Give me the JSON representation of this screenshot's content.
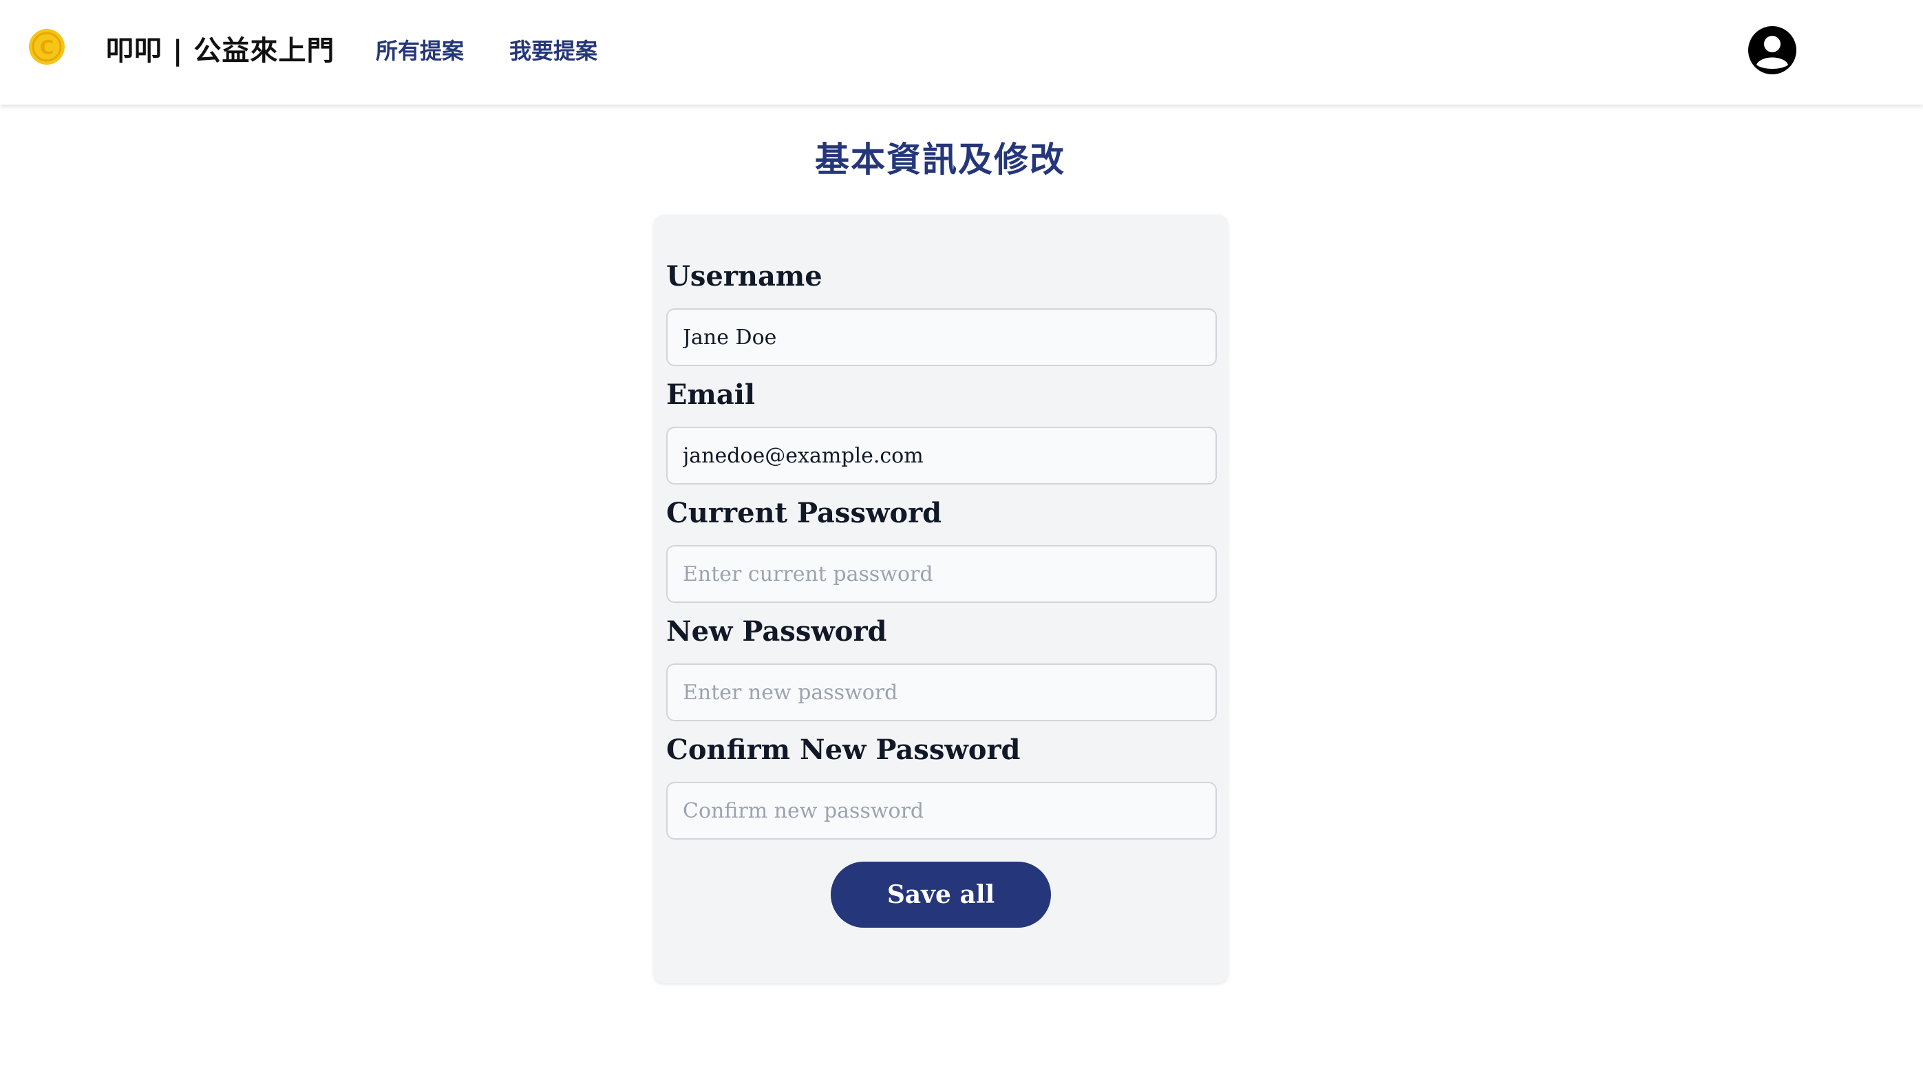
{
  "header": {
    "brand": "叩叩 | 公益來上門",
    "nav": [
      {
        "label": "所有提案"
      },
      {
        "label": "我要提案"
      }
    ],
    "logo_icon": "copyright-coin-icon",
    "avatar_icon": "user-circle-icon"
  },
  "page": {
    "title": "基本資訊及修改"
  },
  "form": {
    "username": {
      "label": "Username",
      "value": "Jane Doe"
    },
    "email": {
      "label": "Email",
      "value": "janedoe@example.com"
    },
    "current_password": {
      "label": "Current Password",
      "placeholder": "Enter current password"
    },
    "new_password": {
      "label": "New Password",
      "placeholder": "Enter new password"
    },
    "confirm_password": {
      "label": "Confirm New Password",
      "placeholder": "Confirm new password"
    },
    "save_label": "Save all"
  },
  "colors": {
    "accent": "#25377a",
    "logo": "#f5c518",
    "card_bg": "#f3f4f6"
  }
}
